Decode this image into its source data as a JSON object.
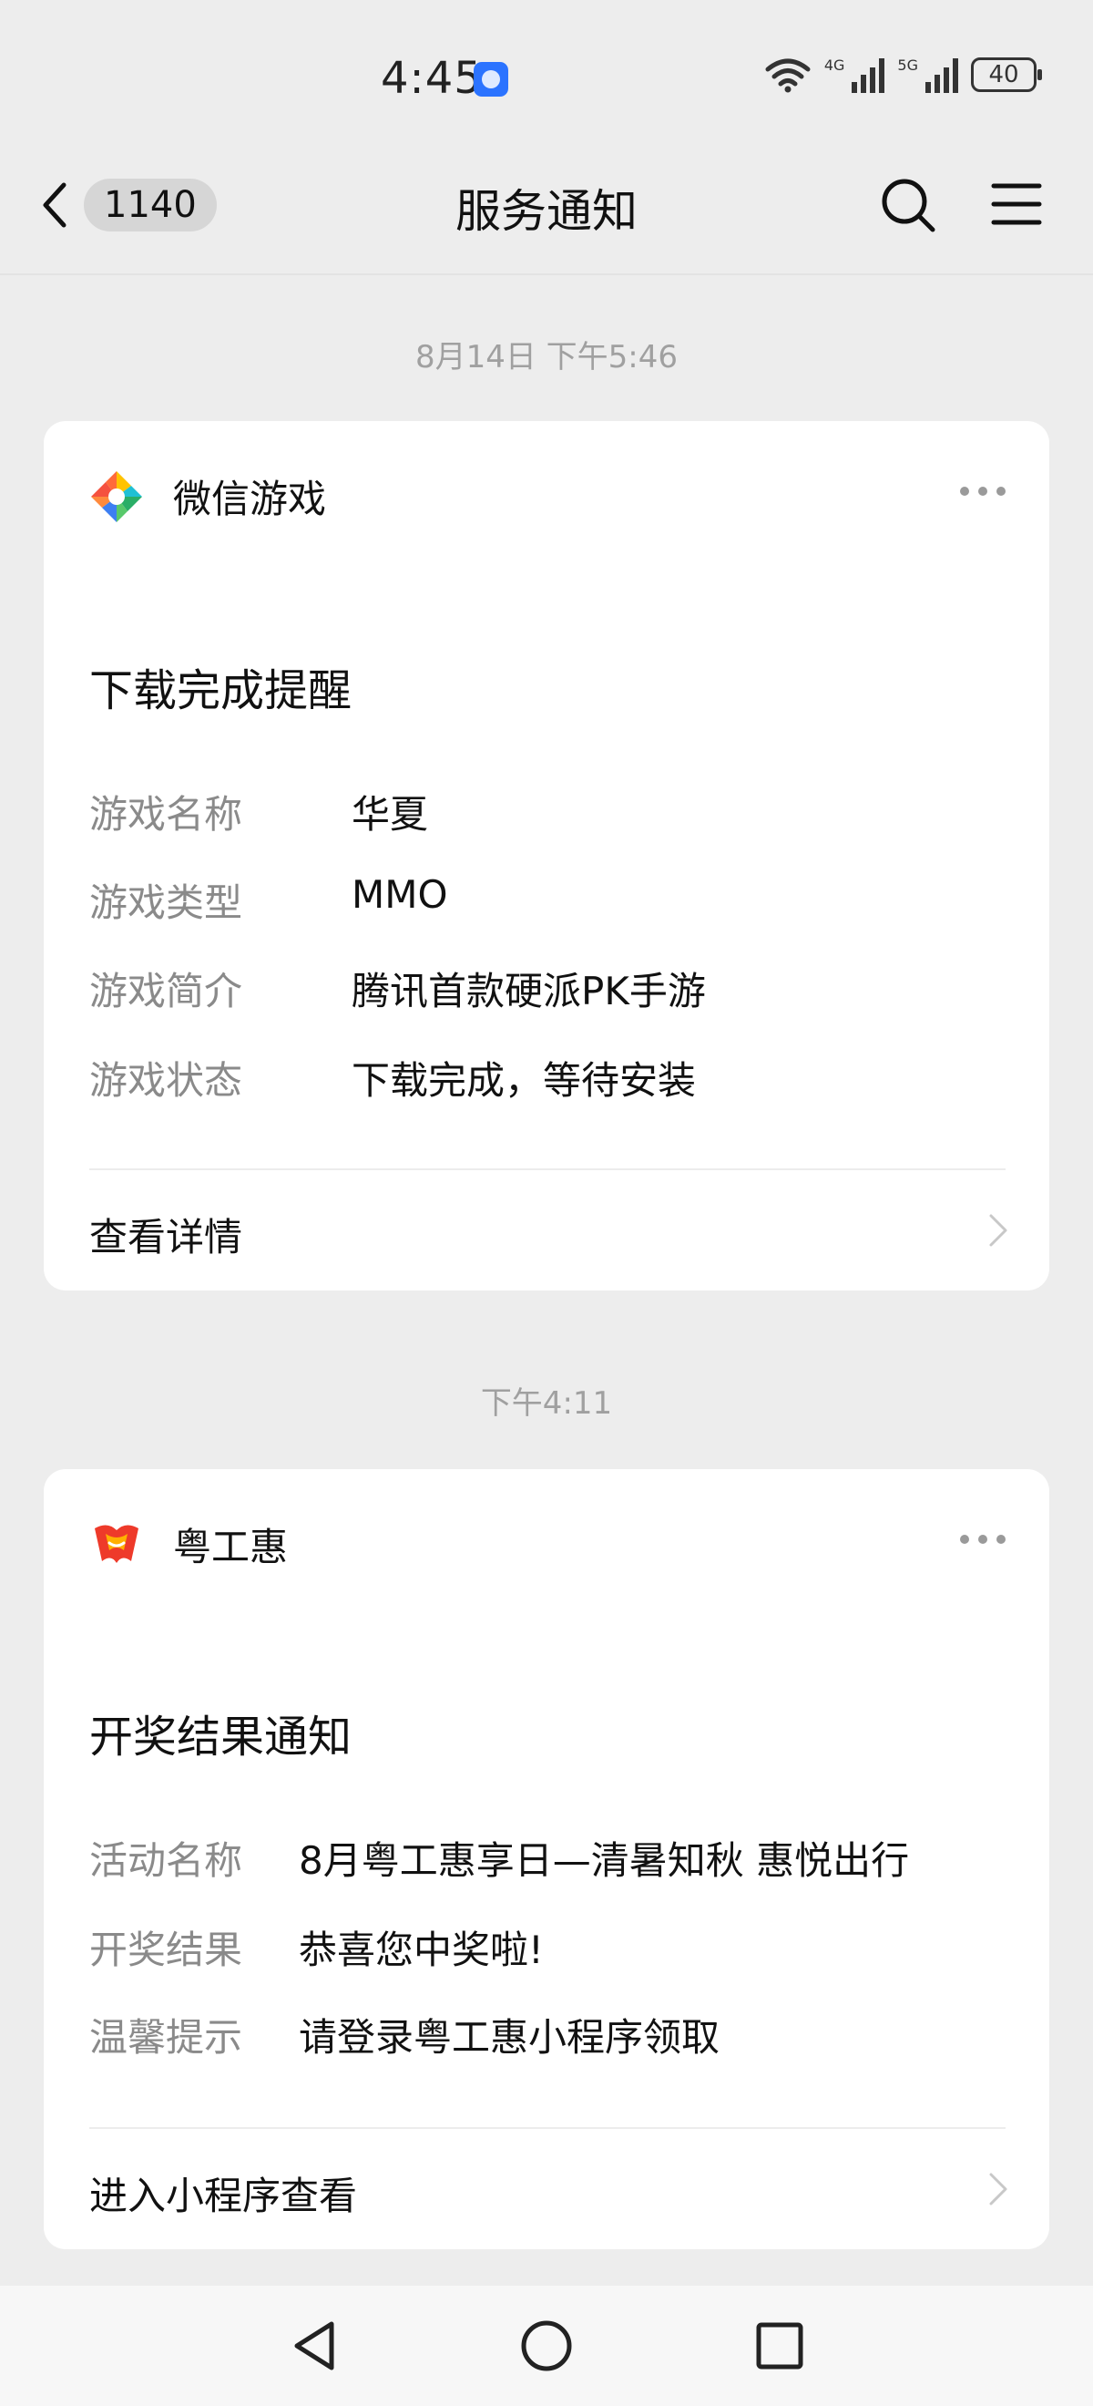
{
  "status_bar": {
    "time": "4:45",
    "signal_1_label": "4G",
    "signal_2_label": "5G",
    "battery": "40"
  },
  "nav": {
    "unread_count": "1140",
    "title": "服务通知"
  },
  "messages": [
    {
      "timestamp": "8月14日 下午5:46",
      "brand": "微信游戏",
      "title": "下载完成提醒",
      "fields": [
        {
          "label": "游戏名称",
          "value": "华夏"
        },
        {
          "label": "游戏类型",
          "value": "MMO"
        },
        {
          "label": "游戏简介",
          "value": "腾讯首款硬派PK手游"
        },
        {
          "label": "游戏状态",
          "value": "下载完成，等待安装"
        }
      ],
      "action": "查看详情"
    },
    {
      "timestamp": "下午4:11",
      "brand": "粤工惠",
      "title": "开奖结果通知",
      "fields": [
        {
          "label": "活动名称",
          "value": "8月粤工惠享日—清暑知秋 惠悦出行"
        },
        {
          "label": "开奖结果",
          "value": "恭喜您中奖啦!"
        },
        {
          "label": "温馨提示",
          "value": "请登录粤工惠小程序领取"
        }
      ],
      "action": "进入小程序查看"
    }
  ],
  "colors": {
    "background": "#ededed",
    "card": "#ffffff",
    "label": "#8a8a8a",
    "timestamp": "#a0a0a0"
  }
}
